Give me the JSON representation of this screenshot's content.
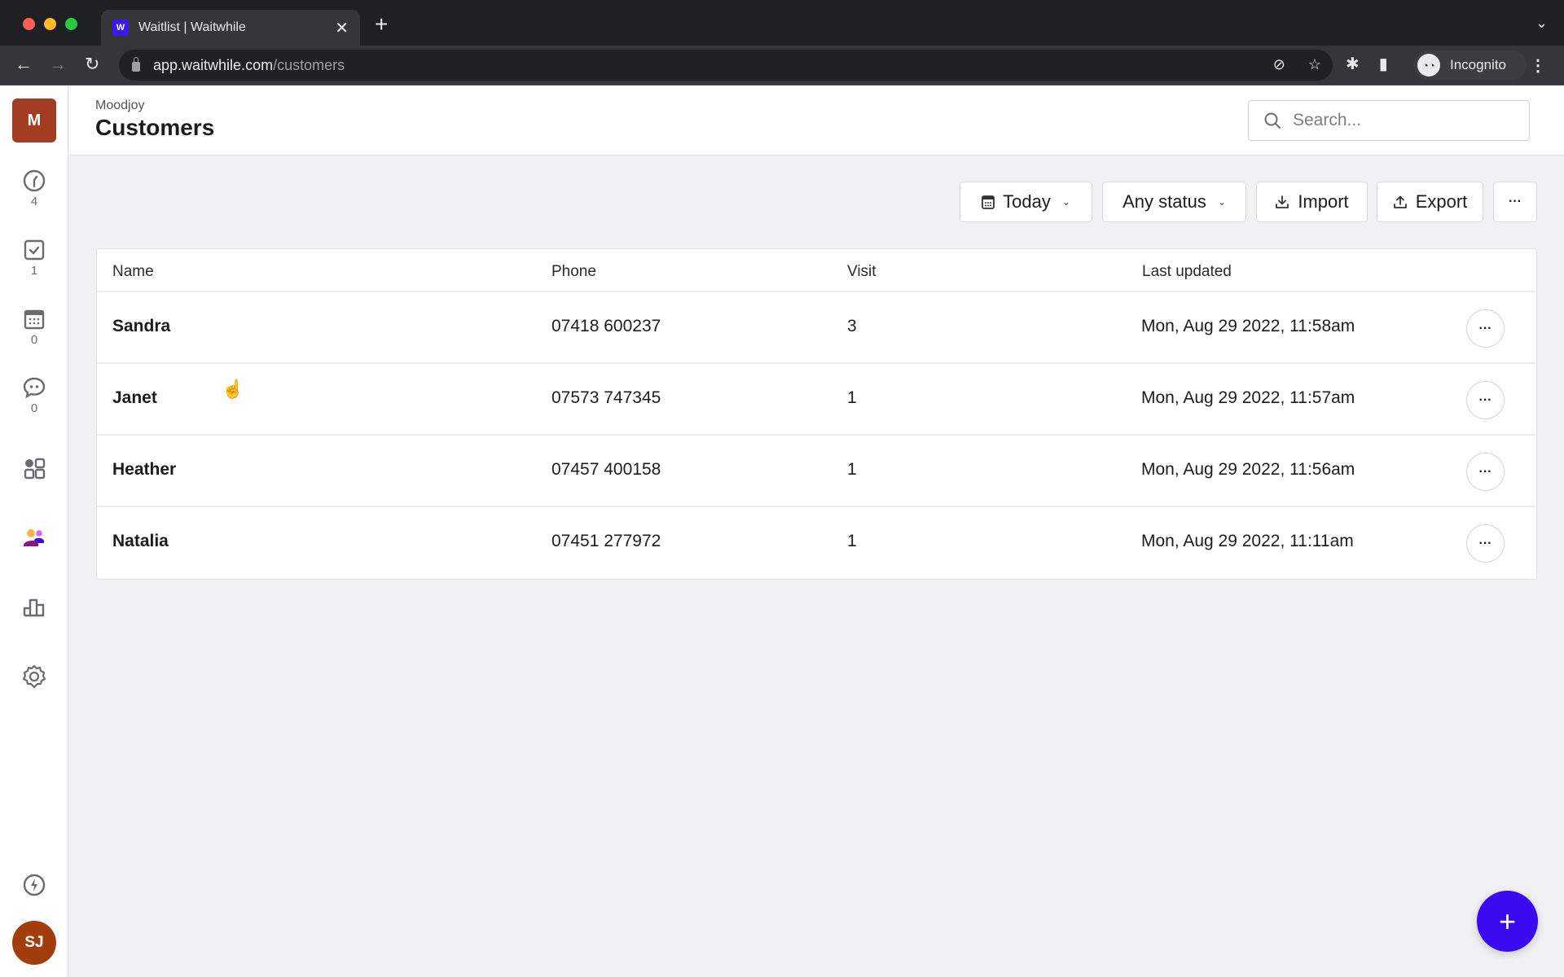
{
  "browser": {
    "tab_title": "Waitlist | Waitwhile",
    "favicon_label": "W",
    "url_host": "app.waitwhile.com",
    "url_path": "/customers",
    "profile_label": "Incognito"
  },
  "sidebar": {
    "org_initial": "M",
    "items": [
      {
        "icon": "clock-icon",
        "count": "4"
      },
      {
        "icon": "checkbox-icon",
        "count": "1"
      },
      {
        "icon": "calendar-icon",
        "count": "0"
      },
      {
        "icon": "chat-icon",
        "count": "0"
      },
      {
        "icon": "apps-grid-icon",
        "count": null
      },
      {
        "icon": "customers-icon",
        "count": null
      },
      {
        "icon": "analytics-icon",
        "count": null
      },
      {
        "icon": "settings-icon",
        "count": null
      }
    ],
    "bolt_icon": "bolt-icon",
    "user_initials": "SJ"
  },
  "header": {
    "org_name": "Moodjoy",
    "title": "Customers",
    "search_placeholder": "Search..."
  },
  "filters": {
    "date_label": "Today",
    "status_label": "Any status",
    "import_label": "Import",
    "export_label": "Export",
    "more_label": "···"
  },
  "table": {
    "columns": [
      "Name",
      "Phone",
      "Visit",
      "Last updated"
    ],
    "rows": [
      {
        "name": "Sandra",
        "phone": "07418 600237",
        "visit": "3",
        "updated": "Mon, Aug 29 2022, 11:58am"
      },
      {
        "name": "Janet",
        "phone": "07573 747345",
        "visit": "1",
        "updated": "Mon, Aug 29 2022, 11:57am"
      },
      {
        "name": "Heather",
        "phone": "07457 400158",
        "visit": "1",
        "updated": "Mon, Aug 29 2022, 11:56am"
      },
      {
        "name": "Natalia",
        "phone": "07451 277972",
        "visit": "1",
        "updated": "Mon, Aug 29 2022, 11:11am"
      }
    ],
    "row_menu_label": "···"
  },
  "fab_label": "+",
  "colors": {
    "accent": "#3c0af0",
    "org_badge": "#a33d22",
    "user_avatar": "#a33d0c"
  }
}
